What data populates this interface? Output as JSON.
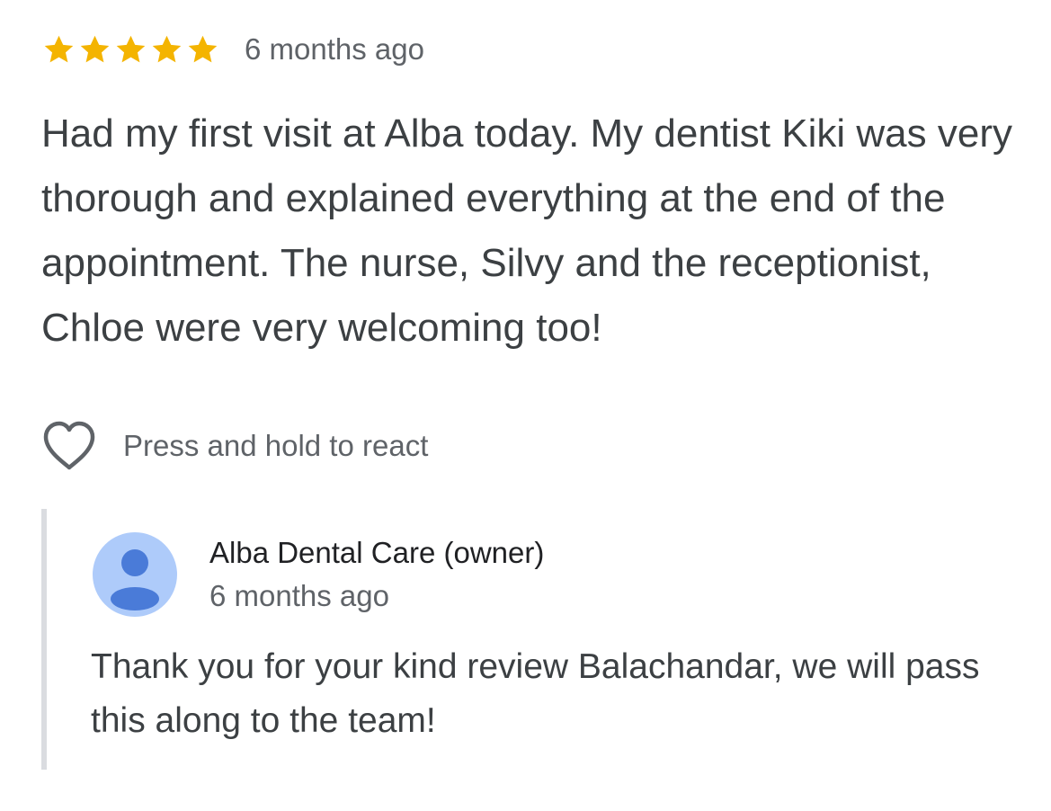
{
  "review": {
    "rating": 5,
    "rating_max": 5,
    "star_color": "#f4b400",
    "time": "6 months ago",
    "text": "Had my first visit at Alba today. My dentist Kiki was very thorough and explained everything at the end of the appointment. The nurse, Silvy and the receptionist, Chloe were very welcoming too!"
  },
  "reaction": {
    "icon": "heart-outline-icon",
    "label": "Press and hold to react"
  },
  "owner_reply": {
    "avatar_icon": "person-icon",
    "avatar_bg": "#aecbfa",
    "avatar_fg": "#4a7bd8",
    "name": "Alba Dental Care (owner)",
    "time": "6 months ago",
    "text": "Thank you for your kind review Balachandar, we will pass this along to the team!"
  }
}
